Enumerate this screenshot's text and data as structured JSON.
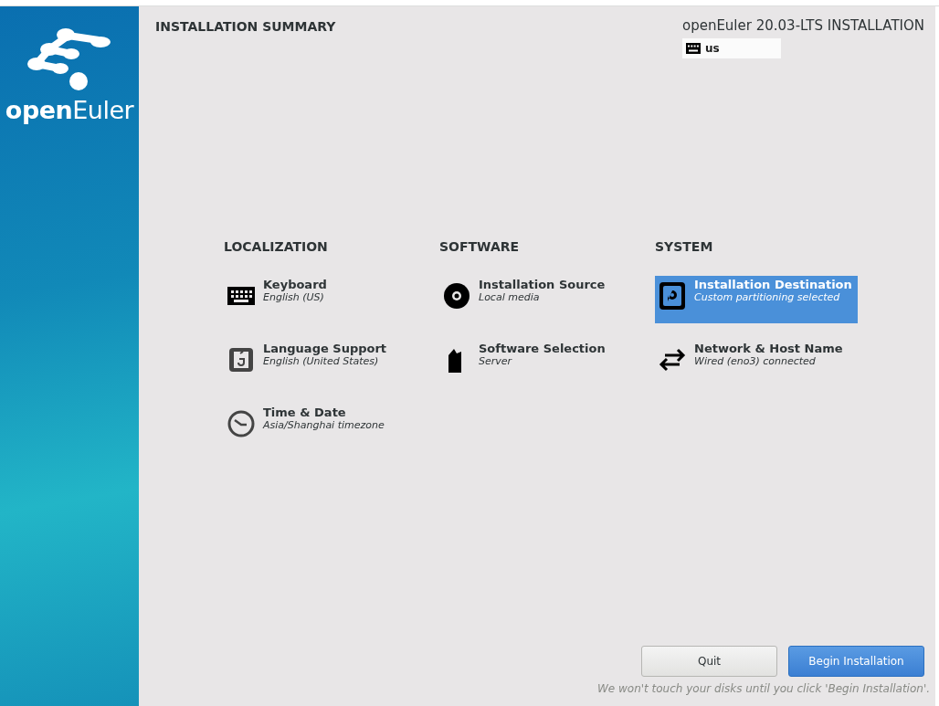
{
  "brand": {
    "name_bold": "open",
    "name_light": "Euler"
  },
  "header": {
    "title": "INSTALLATION SUMMARY",
    "product": "openEuler 20.03-LTS INSTALLATION",
    "keyboard_layout": "us"
  },
  "categories": [
    {
      "title": "LOCALIZATION",
      "spokes": [
        {
          "kind": "keyboard",
          "title": "Keyboard",
          "status": "English (US)",
          "selected": false
        },
        {
          "kind": "language",
          "title": "Language Support",
          "status": "English (United States)",
          "selected": false
        },
        {
          "kind": "clock",
          "title": "Time & Date",
          "status": "Asia/Shanghai timezone",
          "selected": false
        }
      ]
    },
    {
      "title": "SOFTWARE",
      "spokes": [
        {
          "kind": "disc",
          "title": "Installation Source",
          "status": "Local media",
          "selected": false
        },
        {
          "kind": "package",
          "title": "Software Selection",
          "status": "Server",
          "selected": false
        }
      ]
    },
    {
      "title": "SYSTEM",
      "spokes": [
        {
          "kind": "disk",
          "title": "Installation Destination",
          "status": "Custom partitioning selected",
          "selected": true
        },
        {
          "kind": "network",
          "title": "Network & Host Name",
          "status": "Wired (eno3) connected",
          "selected": false
        }
      ]
    }
  ],
  "buttons": [
    {
      "label": "Quit",
      "kind": "secondary"
    },
    {
      "label": "Begin Installation",
      "kind": "primary"
    }
  ],
  "footer_note": "We won't touch your disks until you click 'Begin Installation'."
}
